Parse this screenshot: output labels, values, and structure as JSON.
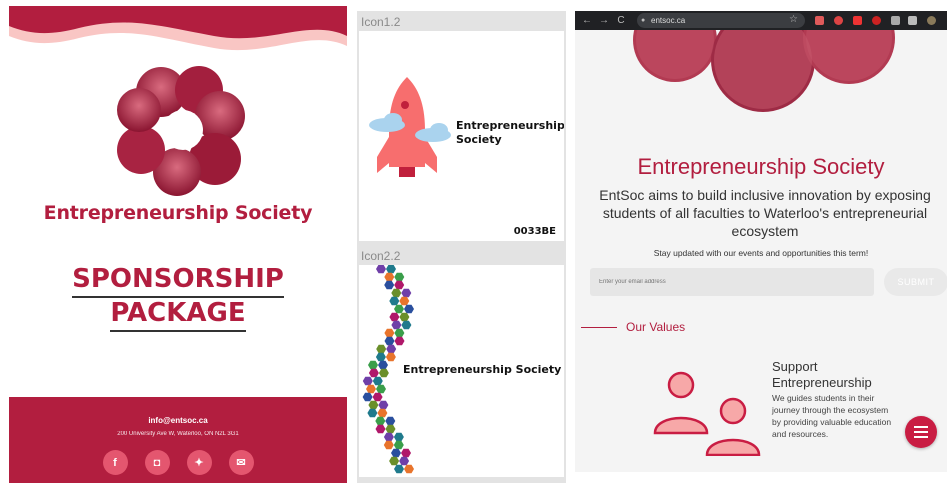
{
  "sponsorship": {
    "org_name": "Entrepreneurship Society",
    "title_line1": "SPONSORSHIP",
    "title_line2": "PACKAGE",
    "email": "info@entsoc.ca",
    "address": "200 University Ave W, Waterloo, ON N2L 3G1",
    "socials": [
      {
        "icon": "facebook-icon",
        "glyph": "f"
      },
      {
        "icon": "instagram-icon",
        "glyph": "◘"
      },
      {
        "icon": "twitter-icon",
        "glyph": "✦"
      },
      {
        "icon": "mail-icon",
        "glyph": "✉"
      }
    ],
    "colors": {
      "brand": "#b21e3f",
      "pink": "#f9c6c4",
      "social": "#e4566f"
    }
  },
  "icons": {
    "icon1_label": "Icon1.2",
    "icon1_text_line1": "Entrepreneurship",
    "icon1_text_line2": "Society",
    "icon1_code": "0033BE",
    "icon2_label": "Icon2.2",
    "icon2_text": "Entrepreneurship Society"
  },
  "browser": {
    "url": "entsoc.ca",
    "nav_back": "←",
    "nav_forward": "→",
    "nav_reload": "C",
    "org_name": "Entrepreneurship Society",
    "tagline": "EntSoc aims to build inclusive innovation by exposing students of all faculties to Waterloo's entrepreneurial ecosystem",
    "stay_updated": "Stay updated with our events and opportunities this term!",
    "email_placeholder": "Enter your email address",
    "submit_label": "SUBMIT",
    "values_heading": "Our Values",
    "value_title_line1": "Support",
    "value_title_line2": "Entrepreneurship",
    "value_desc": "We guides students in their journey through the ecosystem by providing valuable education and resources.",
    "colors": {
      "brand": "#b21e3f",
      "fab": "#c91d43",
      "chrome": "#202124"
    }
  }
}
